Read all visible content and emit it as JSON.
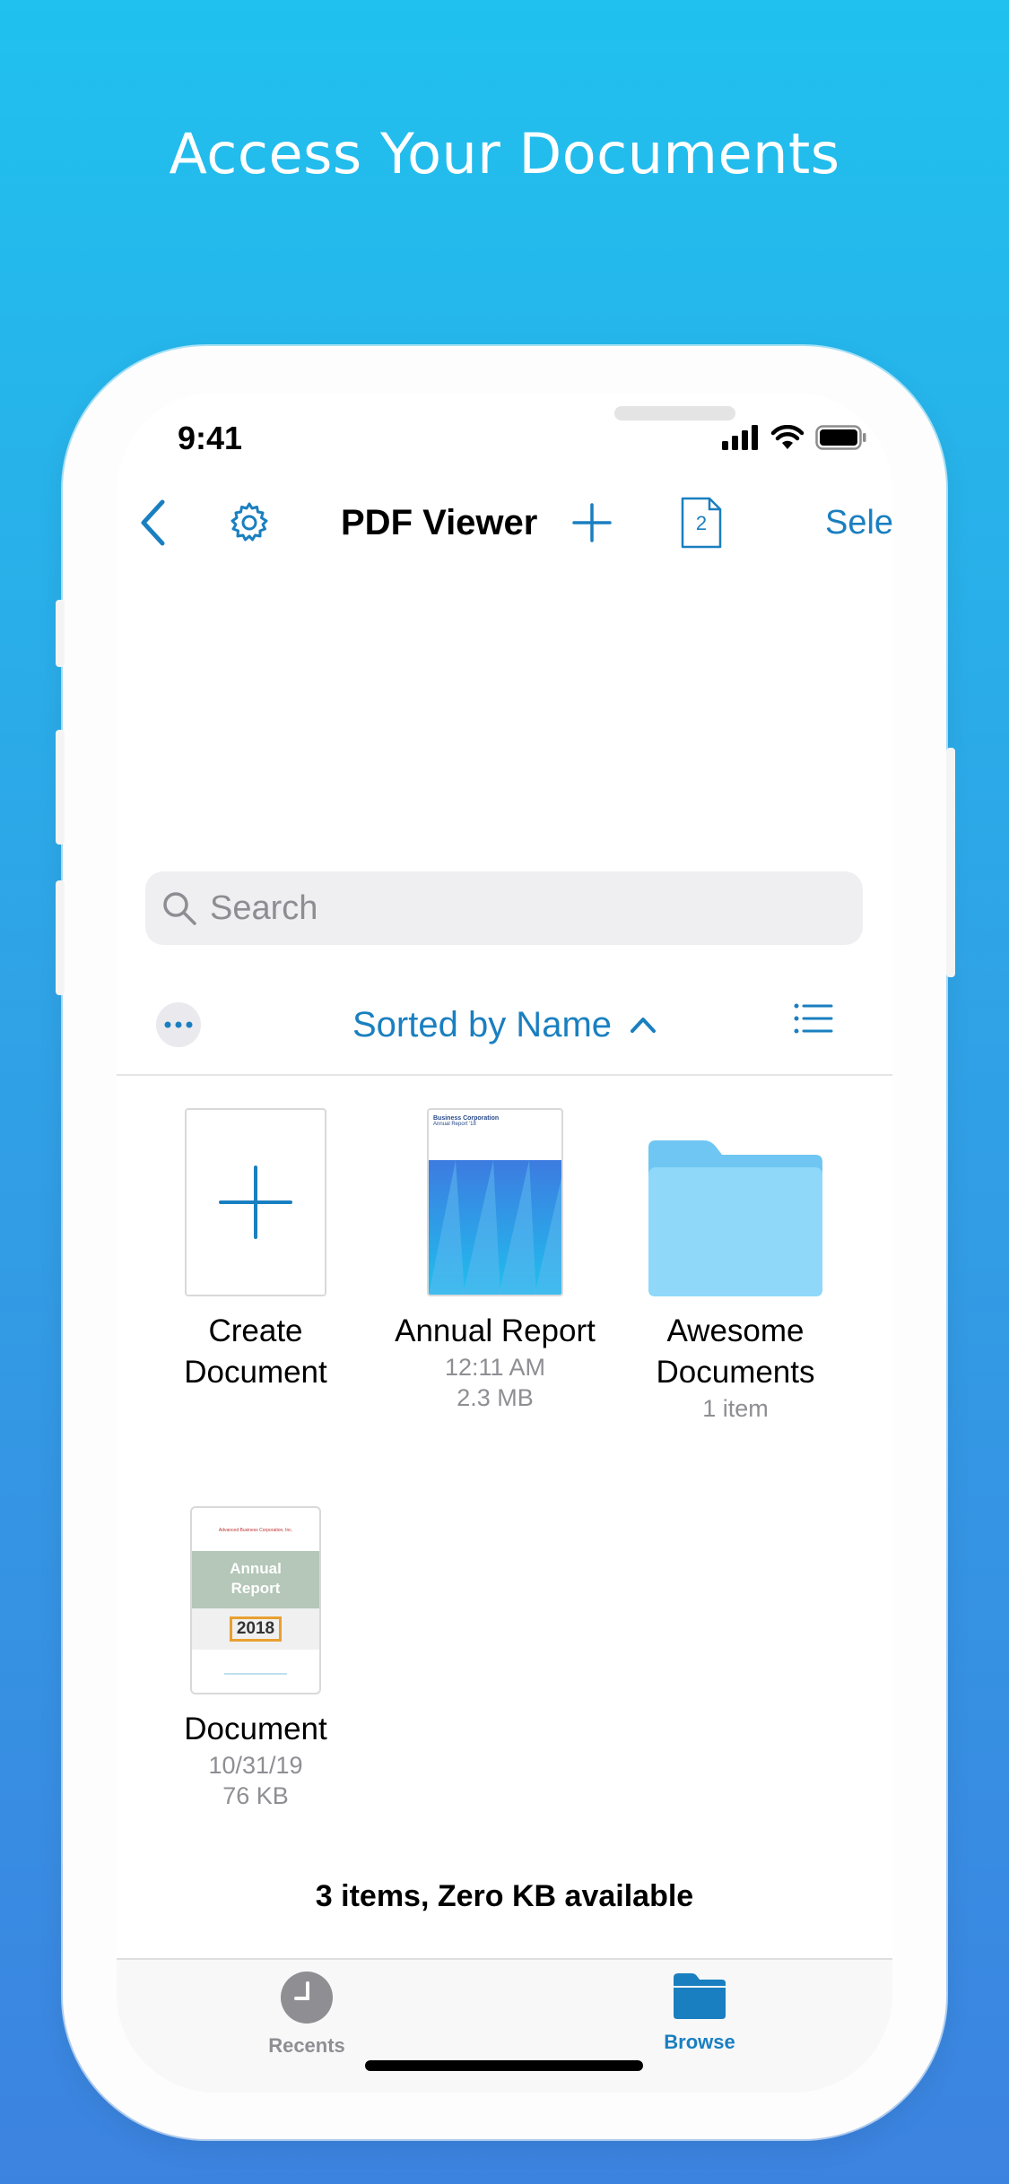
{
  "promo": {
    "headline": "Access Your Documents"
  },
  "status_bar": {
    "time": "9:41"
  },
  "nav": {
    "title": "PDF Viewer",
    "select_label": "Select",
    "tabs_count": "2"
  },
  "search": {
    "placeholder": "Search",
    "value": ""
  },
  "sort": {
    "label": "Sorted by Name"
  },
  "items": [
    {
      "name_line1": "Create",
      "name_line2": "Document",
      "meta1": "",
      "meta2": ""
    },
    {
      "name_line1": "Annual Report",
      "name_line2": "",
      "meta1": "12:11 AM",
      "meta2": "2.3 MB",
      "cover_title": "Business Corporation",
      "cover_subtitle": "Annual Report '18"
    },
    {
      "name_line1": "Awesome",
      "name_line2": "Documents",
      "meta1": "1 item",
      "meta2": ""
    },
    {
      "name_line1": "Document",
      "name_line2": "",
      "meta1": "10/31/19",
      "meta2": "76 KB",
      "cover_header": "Advanced Business Corporation, Inc.",
      "cover_title1": "Annual",
      "cover_title2": "Report",
      "cover_year": "2018"
    }
  ],
  "footer": {
    "storage": "3 items, Zero KB available"
  },
  "tabbar": {
    "recents": "Recents",
    "browse": "Browse"
  },
  "colors": {
    "accent": "#1a7fc0",
    "folder": "#7fd1f7",
    "inactive": "#8e8e93"
  },
  "icons": [
    "back-chevron-icon",
    "gear-icon",
    "plus-icon",
    "tabs-icon",
    "search-icon",
    "more-icon",
    "chevron-up-icon",
    "list-view-icon",
    "clock-icon",
    "folder-icon"
  ]
}
